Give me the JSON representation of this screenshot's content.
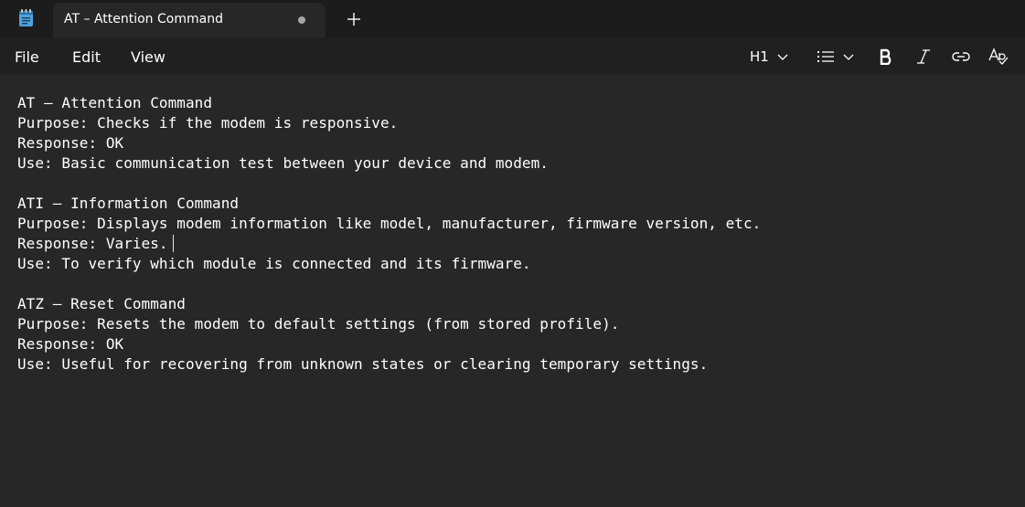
{
  "tab": {
    "title": "AT – Attention Command",
    "unsaved": true
  },
  "menu": {
    "file": "File",
    "edit": "Edit",
    "view": "View"
  },
  "toolbar": {
    "heading_label": "H1",
    "icons": [
      "chevron-down-icon",
      "list-icon",
      "bold-icon",
      "italic-icon",
      "link-icon",
      "spellcheck-icon"
    ]
  },
  "document": {
    "lines": [
      "AT – Attention Command",
      "Purpose: Checks if the modem is responsive.",
      "Response: OK",
      "Use: Basic communication test between your device and modem.",
      "",
      "ATI – Information Command",
      "Purpose: Displays modem information like model, manufacturer, firmware version, etc.",
      "Response: Varies.",
      "Use: To verify which module is connected and its firmware.",
      "",
      "ATZ – Reset Command",
      "Purpose: Resets the modem to default settings (from stored profile).",
      "Response: OK",
      "Use: Useful for recovering from unknown states or clearing temporary settings."
    ]
  },
  "colors": {
    "tabstrip_bg": "#1c1c1c",
    "menubar_bg": "#202020",
    "editor_bg": "#272727",
    "text": "#ffffff",
    "icon_accent": "#4aa3df"
  }
}
